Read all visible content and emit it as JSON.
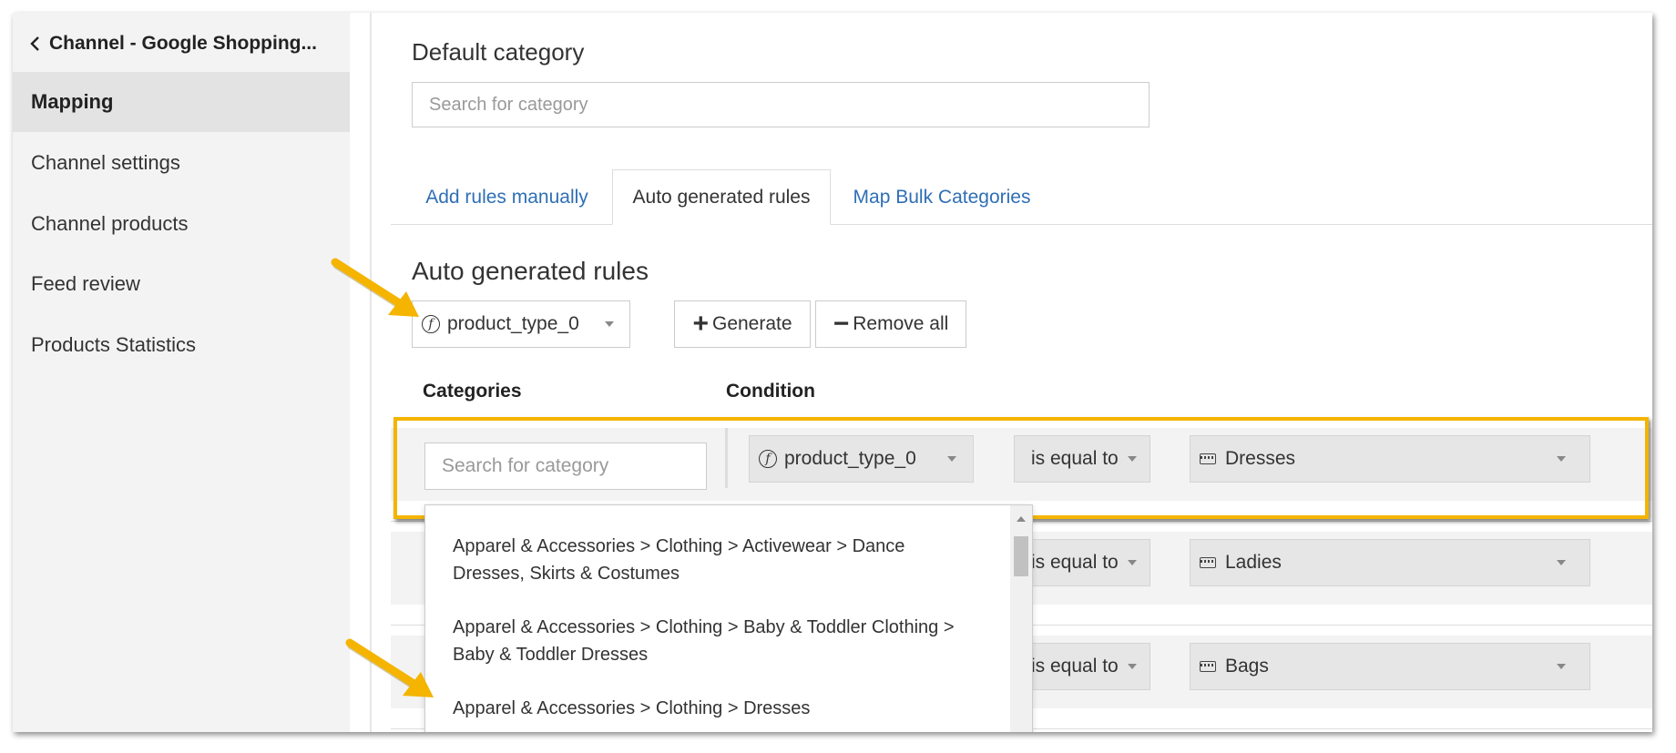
{
  "sidebar": {
    "back_title": "Channel - Google Shopping...",
    "items": [
      {
        "label": "Mapping"
      },
      {
        "label": "Channel settings"
      },
      {
        "label": "Channel products"
      },
      {
        "label": "Feed review"
      },
      {
        "label": "Products Statistics"
      }
    ],
    "active_index": 0
  },
  "main": {
    "default_category_heading": "Default category",
    "default_search_placeholder": "Search for category",
    "tabs": [
      {
        "label": "Add rules manually"
      },
      {
        "label": "Auto generated rules"
      },
      {
        "label": "Map Bulk Categories"
      }
    ],
    "active_tab_index": 1,
    "auto_heading": "Auto generated rules",
    "field_select": {
      "value": "product_type_0",
      "icon": "function-icon"
    },
    "generate_label": "Generate",
    "generate_symbol": "+",
    "remove_all_label": "Remove all",
    "remove_all_symbol": "−",
    "columns": {
      "categories": "Categories",
      "condition": "Condition"
    },
    "rules": [
      {
        "category_placeholder": "Search for category",
        "field": "product_type_0",
        "operator": "is equal to",
        "value": "Dresses",
        "highlighted": true
      },
      {
        "operator": "is equal to",
        "value": "Ladies"
      },
      {
        "operator": "is equal to",
        "value": "Bags"
      }
    ],
    "category_suggestions": [
      {
        "line1": "Apparel & Accessories > Clothing > Activewear > Dance",
        "line2": "Dresses, Skirts & Costumes"
      },
      {
        "line1": "Apparel & Accessories > Clothing > Baby & Toddler Clothing >",
        "line2": "Baby & Toddler Dresses"
      },
      {
        "line1": "Apparel & Accessories > Clothing > Dresses",
        "line2": ""
      }
    ]
  },
  "colors": {
    "highlight_border": "#f4b400",
    "annotation_arrow": "#f4b400",
    "link_blue": "#2f6fb5",
    "sidebar_bg": "#f3f3f3",
    "active_nav_bg": "#e3e3e3"
  },
  "annotations": [
    {
      "type": "arrow",
      "points_to": "field-select"
    },
    {
      "type": "arrow",
      "points_to": "category-suggestion-dresses"
    }
  ]
}
